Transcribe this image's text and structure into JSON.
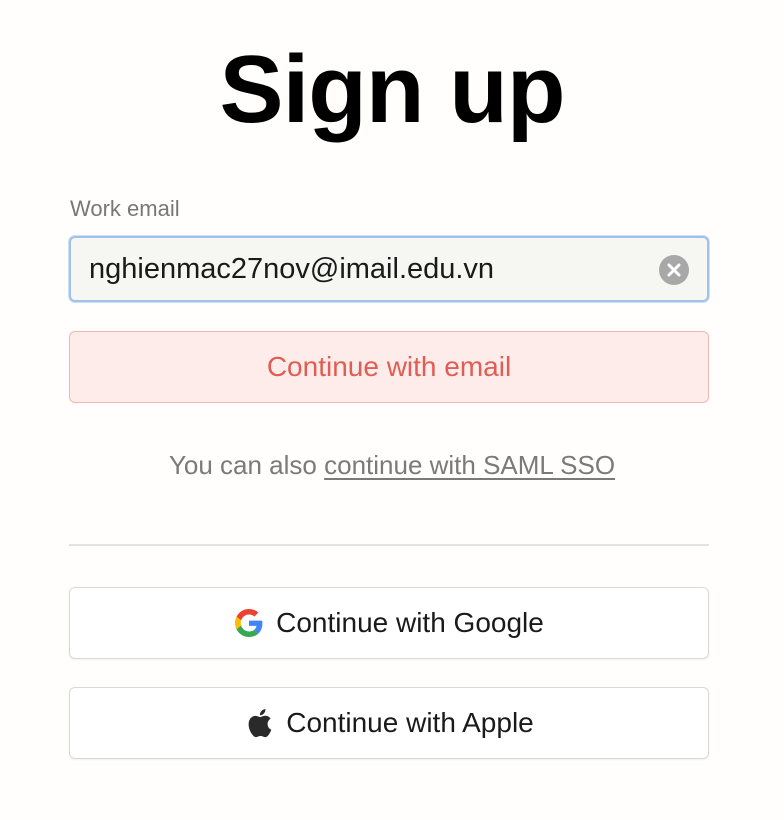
{
  "title": "Sign up",
  "email_field": {
    "label": "Work email",
    "value": "nghienmac27nov@imail.edu.vn"
  },
  "continue_email": {
    "label": "Continue with email"
  },
  "sso": {
    "prefix": "You can also ",
    "link": "continue with SAML SSO"
  },
  "google": {
    "label": "Continue with Google",
    "icon": "google-icon"
  },
  "apple": {
    "label": "Continue with Apple",
    "icon": "apple-icon"
  },
  "colors": {
    "primary_button_text": "#e05d53",
    "primary_button_bg": "#fdecea",
    "input_focus_border": "#9fc2ea"
  }
}
